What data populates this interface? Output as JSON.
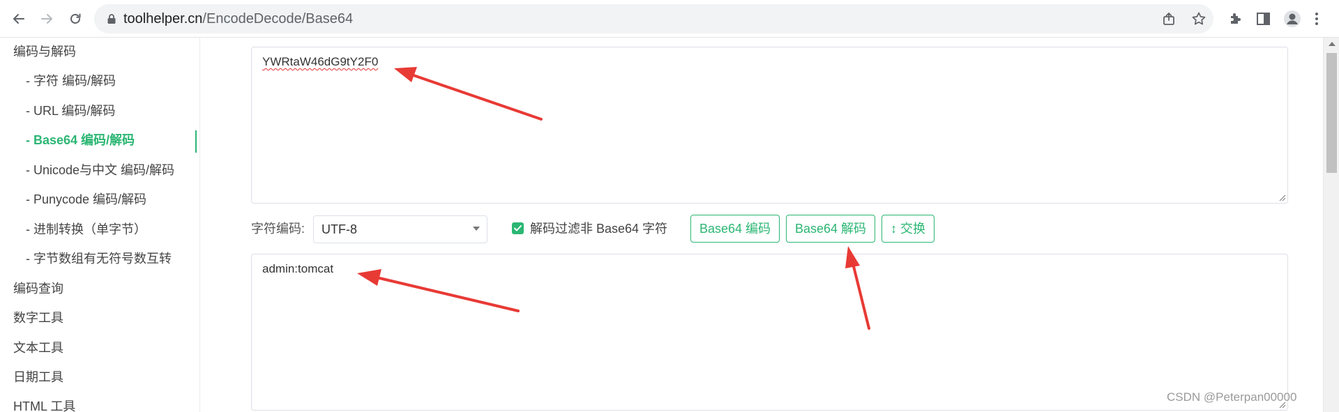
{
  "browser": {
    "url_domain": "toolhelper.cn",
    "url_path": "/EncodeDecode/Base64",
    "icons": [
      "back-arrow-icon",
      "forward-arrow-icon",
      "reload-icon",
      "lock-icon",
      "share-icon",
      "star-icon",
      "puzzle-extensions-icon",
      "side-panel-icon",
      "profile-avatar-icon",
      "more-menu-icon"
    ]
  },
  "sidebar": {
    "items": [
      {
        "label": "编码与解码",
        "level": "top"
      },
      {
        "label": "- 字符  编码/解码",
        "level": "sub"
      },
      {
        "label": "- URL  编码/解码",
        "level": "sub"
      },
      {
        "label": "- Base64  编码/解码",
        "level": "sub",
        "active": true
      },
      {
        "label": "- Unicode与中文  编码/解码",
        "level": "sub"
      },
      {
        "label": "- Punycode  编码/解码",
        "level": "sub"
      },
      {
        "label": "- 进制转换（单字节）",
        "level": "sub"
      },
      {
        "label": "- 字节数组有无符号数互转",
        "level": "sub"
      },
      {
        "label": "编码查询",
        "level": "top"
      },
      {
        "label": "数字工具",
        "level": "top"
      },
      {
        "label": "文本工具",
        "level": "top"
      },
      {
        "label": "日期工具",
        "level": "top"
      },
      {
        "label": "HTML 工具",
        "level": "top"
      }
    ]
  },
  "main": {
    "input_text": "YWRtaW46dG9tY2F0",
    "encoding_label": "字符编码:",
    "encoding_value": "UTF-8",
    "filter_checkbox_label": "解码过滤非 Base64 字符",
    "filter_checked": true,
    "encode_button": "Base64 编码",
    "decode_button": "Base64 解码",
    "swap_button": "↕ 交换",
    "output_text": "admin:tomcat"
  },
  "watermark": "CSDN @Peterpan00000",
  "colors": {
    "accent": "#2bb673",
    "annotation_arrow": "#e83a35"
  }
}
